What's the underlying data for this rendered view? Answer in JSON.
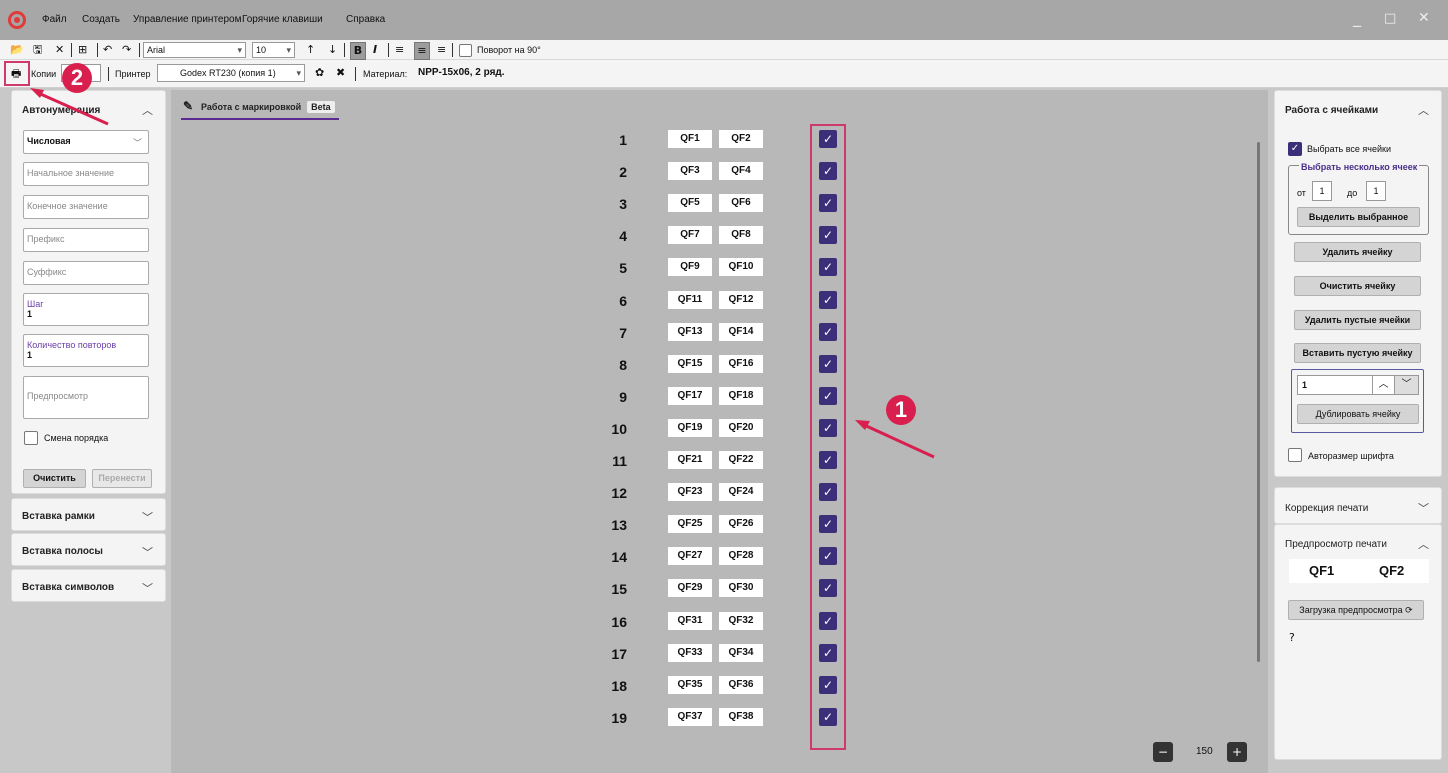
{
  "menu": {
    "items": [
      "Файл",
      "Создать",
      "Управление принтером",
      "Горячие клавиши",
      "Справка"
    ]
  },
  "window_controls": [
    "_",
    "□",
    "✕"
  ],
  "toolbar": {
    "font": "Arial",
    "size": "10",
    "bold": "B",
    "italic": "I",
    "rotate_label": "Поворот на 90°"
  },
  "toolbar2": {
    "copies_label": "Копии",
    "printer_label": "Принтер",
    "printer_value": "Godex RT230 (копия 1)",
    "material_label": "Материал:",
    "material_value": "NPP-15x06, 2 ряд."
  },
  "left": {
    "autonumber_title": "Автонумерация",
    "type_value": "Числовая",
    "start_placeholder": "Начальное значение",
    "end_placeholder": "Конечное значение",
    "prefix_placeholder": "Префикс",
    "suffix_placeholder": "Суффикс",
    "step_label": "Шаг",
    "step_value": "1",
    "repeat_label": "Количество повторов",
    "repeat_value": "1",
    "preview_placeholder": "Предпросмотр",
    "reverse_label": "Смена порядка",
    "clear_button": "Очистить",
    "transfer_button": "Перенести",
    "frame_title": "Вставка рамки",
    "strip_title": "Вставка полосы",
    "symbols_title": "Вставка символов"
  },
  "center": {
    "tab_label": "Работа с маркировкой",
    "tab_badge": "Beta",
    "rows": [
      {
        "n": "1",
        "a": "QF1",
        "b": "QF2"
      },
      {
        "n": "2",
        "a": "QF3",
        "b": "QF4"
      },
      {
        "n": "3",
        "a": "QF5",
        "b": "QF6"
      },
      {
        "n": "4",
        "a": "QF7",
        "b": "QF8"
      },
      {
        "n": "5",
        "a": "QF9",
        "b": "QF10"
      },
      {
        "n": "6",
        "a": "QF11",
        "b": "QF12"
      },
      {
        "n": "7",
        "a": "QF13",
        "b": "QF14"
      },
      {
        "n": "8",
        "a": "QF15",
        "b": "QF16"
      },
      {
        "n": "9",
        "a": "QF17",
        "b": "QF18"
      },
      {
        "n": "10",
        "a": "QF19",
        "b": "QF20"
      },
      {
        "n": "11",
        "a": "QF21",
        "b": "QF22"
      },
      {
        "n": "12",
        "a": "QF23",
        "b": "QF24"
      },
      {
        "n": "13",
        "a": "QF25",
        "b": "QF26"
      },
      {
        "n": "14",
        "a": "QF27",
        "b": "QF28"
      },
      {
        "n": "15",
        "a": "QF29",
        "b": "QF30"
      },
      {
        "n": "16",
        "a": "QF31",
        "b": "QF32"
      },
      {
        "n": "17",
        "a": "QF33",
        "b": "QF34"
      },
      {
        "n": "18",
        "a": "QF35",
        "b": "QF36"
      },
      {
        "n": "19",
        "a": "QF37",
        "b": "QF38"
      }
    ],
    "zoom": "150"
  },
  "right": {
    "cells_title": "Работа с ячейками",
    "select_all": "Выбрать все ячейки",
    "select_several": "Выбрать несколько ячеек",
    "from_label": "от",
    "from_value": "1",
    "to_label": "до",
    "to_value": "1",
    "highlight_button": "Выделить выбранное",
    "delete_button": "Удалить ячейку",
    "clear_button": "Очистить ячейку",
    "delete_empty_button": "Удалить пустые ячейки",
    "insert_empty_button": "Вставить пустую ячейку",
    "dup_value": "1",
    "duplicate_button": "Дублировать ячейку",
    "autosize_label": "Авторазмер шрифта",
    "correction_title": "Коррекция печати",
    "preview_title": "Предпросмотр печати",
    "preview_a": "QF1",
    "preview_b": "QF2",
    "load_preview": "Загрузка предпросмотра"
  },
  "annotations": {
    "badge1": "1",
    "badge2": "2"
  },
  "colors": {
    "accent": "#3b2f7a",
    "annotation": "#d81f4e"
  }
}
